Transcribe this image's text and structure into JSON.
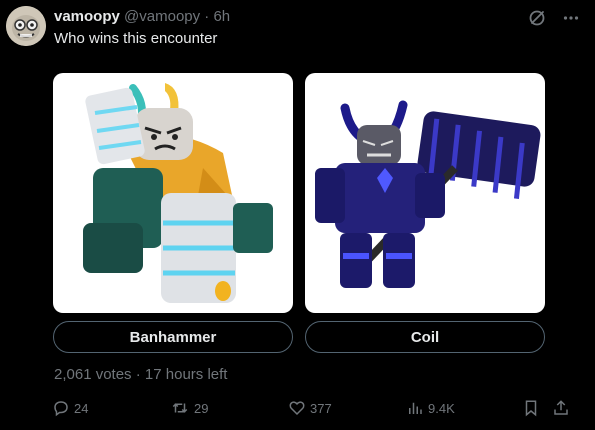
{
  "post": {
    "display_name": "vamoopy",
    "handle": "@vamoopy",
    "separator": "·",
    "time": "6h",
    "text": "Who wins this encounter"
  },
  "poll": {
    "options": [
      {
        "label": "Banhammer"
      },
      {
        "label": "Coil"
      }
    ],
    "votes": "2,061 votes",
    "separator": "·",
    "time_left": "17 hours left"
  },
  "actions": {
    "replies": "24",
    "reposts": "29",
    "likes": "377",
    "views": "9.4K"
  },
  "icons": {
    "avatar": "avatar",
    "grok": "slash-circle-icon",
    "more": "more-icon",
    "reply": "reply-icon",
    "repost": "repost-icon",
    "like": "heart-icon",
    "views": "views-icon",
    "bookmark": "bookmark-icon",
    "share": "share-icon"
  },
  "colors": {
    "background": "#000000",
    "text": "#e7e9ea",
    "muted": "#71767b",
    "border": "#536471"
  }
}
